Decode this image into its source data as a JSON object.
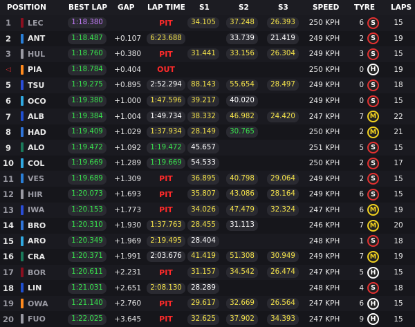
{
  "headers": {
    "position": "POSITION",
    "best_lap": "BEST LAP",
    "gap": "GAP",
    "lap_time": "LAP TIME",
    "s1": "S1",
    "s2": "S2",
    "s3": "S3",
    "speed": "SPEED",
    "tyre": "TYRE",
    "laps": "LAPS"
  },
  "colors": {
    "purple": "#c77dff",
    "green": "#38e54d",
    "yellow": "#f4e34a",
    "red": "#ff2a2a",
    "soft": "#e33131",
    "medium": "#f2d21f",
    "hard": "#ffffff"
  },
  "rows": [
    {
      "pos": "1",
      "team_color": "#8b0f1f",
      "name": "LEC",
      "best": "1:18.380",
      "best_style": "purple",
      "gap": "",
      "lap": "PIT",
      "lap_style": "pit",
      "s1": "34.105",
      "s1_style": "yellow",
      "s2": "37.248",
      "s2_style": "yellow",
      "s3": "26.393",
      "s3_style": "yellow",
      "speed": "250 KPH",
      "tyre_num": "6",
      "tyre": "S",
      "tyre_type": "soft",
      "laps": "15",
      "dim": true
    },
    {
      "pos": "2",
      "team_color": "#2a7fd8",
      "name": "ANT",
      "best": "1:18.487",
      "best_style": "green",
      "gap": "+0.107",
      "lap": "6:23.688",
      "lap_style": "yellow",
      "s1": "",
      "s1_style": "",
      "s2": "33.739",
      "s2_style": "white",
      "s3": "21.419",
      "s3_style": "white",
      "speed": "249 KPH",
      "tyre_num": "2",
      "tyre": "S",
      "tyre_type": "soft",
      "laps": "19",
      "dim": false
    },
    {
      "pos": "3",
      "team_color": "#9a9aa3",
      "name": "HUL",
      "best": "1:18.760",
      "best_style": "green",
      "gap": "+0.380",
      "lap": "PIT",
      "lap_style": "pit",
      "s1": "31.441",
      "s1_style": "yellow",
      "s2": "33.156",
      "s2_style": "yellow",
      "s3": "26.304",
      "s3_style": "yellow",
      "speed": "249 KPH",
      "tyre_num": "3",
      "tyre": "S",
      "tyre_type": "soft",
      "laps": "15",
      "dim": true
    },
    {
      "pos": "◁",
      "team_color": "#ff8a1e",
      "name": "PIA",
      "best": "1:18.784",
      "best_style": "green",
      "gap": "+0.404",
      "lap": "OUT",
      "lap_style": "out",
      "s1": "",
      "s1_style": "",
      "s2": "",
      "s2_style": "",
      "s3": "",
      "s3_style": "",
      "speed": "250 KPH",
      "tyre_num": "0",
      "tyre": "H",
      "tyre_type": "hard",
      "laps": "19",
      "dim": false
    },
    {
      "pos": "5",
      "team_color": "#2a4dd8",
      "name": "TSU",
      "best": "1:19.275",
      "best_style": "green",
      "gap": "+0.895",
      "lap": "2:52.294",
      "lap_style": "white",
      "s1": "88.143",
      "s1_style": "yellow",
      "s2": "55.654",
      "s2_style": "yellow",
      "s3": "28.497",
      "s3_style": "yellow",
      "speed": "249 KPH",
      "tyre_num": "0",
      "tyre": "S",
      "tyre_type": "soft",
      "laps": "18",
      "dim": false
    },
    {
      "pos": "6",
      "team_color": "#2fa8e0",
      "name": "OCO",
      "best": "1:19.380",
      "best_style": "green",
      "gap": "+1.000",
      "lap": "1:47.596",
      "lap_style": "yellow",
      "s1": "39.217",
      "s1_style": "yellow",
      "s2": "40.020",
      "s2_style": "white",
      "s3": "",
      "s3_style": "",
      "speed": "249 KPH",
      "tyre_num": "0",
      "tyre": "S",
      "tyre_type": "soft",
      "laps": "15",
      "dim": false
    },
    {
      "pos": "7",
      "team_color": "#1f4fd0",
      "name": "ALB",
      "best": "1:19.384",
      "best_style": "green",
      "gap": "+1.004",
      "lap": "1:49.734",
      "lap_style": "white",
      "s1": "38.332",
      "s1_style": "yellow",
      "s2": "46.982",
      "s2_style": "yellow",
      "s3": "24.420",
      "s3_style": "yellow",
      "speed": "247 KPH",
      "tyre_num": "7",
      "tyre": "M",
      "tyre_type": "medium",
      "laps": "22",
      "dim": false
    },
    {
      "pos": "8",
      "team_color": "#2f74d8",
      "name": "HAD",
      "best": "1:19.409",
      "best_style": "green",
      "gap": "+1.029",
      "lap": "1:37.934",
      "lap_style": "yellow",
      "s1": "28.149",
      "s1_style": "yellow",
      "s2": "30.765",
      "s2_style": "green",
      "s3": "",
      "s3_style": "",
      "speed": "250 KPH",
      "tyre_num": "2",
      "tyre": "M",
      "tyre_type": "medium",
      "laps": "21",
      "dim": false
    },
    {
      "pos": "9",
      "team_color": "#1a7a5a",
      "name": "ALO",
      "best": "1:19.472",
      "best_style": "green",
      "gap": "+1.092",
      "lap": "1:19.472",
      "lap_style": "green",
      "s1": "45.657",
      "s1_style": "white",
      "s2": "",
      "s2_style": "",
      "s3": "",
      "s3_style": "",
      "speed": "251 KPH",
      "tyre_num": "5",
      "tyre": "S",
      "tyre_type": "soft",
      "laps": "15",
      "dim": false
    },
    {
      "pos": "10",
      "team_color": "#2fa8e0",
      "name": "COL",
      "best": "1:19.669",
      "best_style": "green",
      "gap": "+1.289",
      "lap": "1:19.669",
      "lap_style": "green",
      "s1": "54.533",
      "s1_style": "white",
      "s2": "",
      "s2_style": "",
      "s3": "",
      "s3_style": "",
      "speed": "250 KPH",
      "tyre_num": "2",
      "tyre": "S",
      "tyre_type": "soft",
      "laps": "17",
      "dim": false
    },
    {
      "pos": "11",
      "team_color": "#2a7fd8",
      "name": "VES",
      "best": "1:19.689",
      "best_style": "green",
      "gap": "+1.309",
      "lap": "PIT",
      "lap_style": "pit",
      "s1": "36.895",
      "s1_style": "yellow",
      "s2": "40.798",
      "s2_style": "yellow",
      "s3": "29.064",
      "s3_style": "yellow",
      "speed": "249 KPH",
      "tyre_num": "2",
      "tyre": "S",
      "tyre_type": "soft",
      "laps": "15",
      "dim": true
    },
    {
      "pos": "12",
      "team_color": "#9a9aa3",
      "name": "HIR",
      "best": "1:20.073",
      "best_style": "green",
      "gap": "+1.693",
      "lap": "PIT",
      "lap_style": "pit",
      "s1": "35.807",
      "s1_style": "yellow",
      "s2": "43.086",
      "s2_style": "yellow",
      "s3": "28.164",
      "s3_style": "yellow",
      "speed": "249 KPH",
      "tyre_num": "6",
      "tyre": "S",
      "tyre_type": "soft",
      "laps": "15",
      "dim": true
    },
    {
      "pos": "13",
      "team_color": "#2a4dd8",
      "name": "IWA",
      "best": "1:20.153",
      "best_style": "green",
      "gap": "+1.773",
      "lap": "PIT",
      "lap_style": "pit",
      "s1": "34.026",
      "s1_style": "yellow",
      "s2": "47.479",
      "s2_style": "yellow",
      "s3": "32.324",
      "s3_style": "yellow",
      "speed": "247 KPH",
      "tyre_num": "6",
      "tyre": "M",
      "tyre_type": "medium",
      "laps": "19",
      "dim": true
    },
    {
      "pos": "14",
      "team_color": "#2f74d8",
      "name": "BRO",
      "best": "1:20.310",
      "best_style": "green",
      "gap": "+1.930",
      "lap": "1:37.763",
      "lap_style": "yellow",
      "s1": "28.455",
      "s1_style": "yellow",
      "s2": "31.113",
      "s2_style": "white",
      "s3": "",
      "s3_style": "",
      "speed": "246 KPH",
      "tyre_num": "7",
      "tyre": "M",
      "tyre_type": "medium",
      "laps": "20",
      "dim": false
    },
    {
      "pos": "15",
      "team_color": "#2fa8e0",
      "name": "ARO",
      "best": "1:20.349",
      "best_style": "green",
      "gap": "+1.969",
      "lap": "2:19.495",
      "lap_style": "yellow",
      "s1": "28.404",
      "s1_style": "white",
      "s2": "",
      "s2_style": "",
      "s3": "",
      "s3_style": "",
      "speed": "248 KPH",
      "tyre_num": "1",
      "tyre": "S",
      "tyre_type": "soft",
      "laps": "18",
      "dim": false
    },
    {
      "pos": "16",
      "team_color": "#1a7a5a",
      "name": "CRA",
      "best": "1:20.371",
      "best_style": "green",
      "gap": "+1.991",
      "lap": "2:03.676",
      "lap_style": "white",
      "s1": "41.419",
      "s1_style": "yellow",
      "s2": "51.308",
      "s2_style": "yellow",
      "s3": "30.949",
      "s3_style": "yellow",
      "speed": "249 KPH",
      "tyre_num": "7",
      "tyre": "M",
      "tyre_type": "medium",
      "laps": "19",
      "dim": false
    },
    {
      "pos": "17",
      "team_color": "#8b0f1f",
      "name": "BOR",
      "best": "1:20.611",
      "best_style": "green",
      "gap": "+2.231",
      "lap": "PIT",
      "lap_style": "pit",
      "s1": "31.157",
      "s1_style": "yellow",
      "s2": "34.542",
      "s2_style": "yellow",
      "s3": "26.474",
      "s3_style": "yellow",
      "speed": "247 KPH",
      "tyre_num": "5",
      "tyre": "H",
      "tyre_type": "hard",
      "laps": "15",
      "dim": true
    },
    {
      "pos": "18",
      "team_color": "#1f4fd0",
      "name": "LIN",
      "best": "1:21.031",
      "best_style": "green",
      "gap": "+2.651",
      "lap": "2:08.130",
      "lap_style": "yellow",
      "s1": "28.289",
      "s1_style": "white",
      "s2": "",
      "s2_style": "",
      "s3": "",
      "s3_style": "",
      "speed": "248 KPH",
      "tyre_num": "4",
      "tyre": "S",
      "tyre_type": "soft",
      "laps": "18",
      "dim": false
    },
    {
      "pos": "19",
      "team_color": "#ff8a1e",
      "name": "OWA",
      "best": "1:21.140",
      "best_style": "green",
      "gap": "+2.760",
      "lap": "PIT",
      "lap_style": "pit",
      "s1": "29.617",
      "s1_style": "yellow",
      "s2": "32.669",
      "s2_style": "yellow",
      "s3": "26.564",
      "s3_style": "yellow",
      "speed": "247 KPH",
      "tyre_num": "6",
      "tyre": "H",
      "tyre_type": "hard",
      "laps": "15",
      "dim": true
    },
    {
      "pos": "20",
      "team_color": "#9a9aa3",
      "name": "FUO",
      "best": "1:22.025",
      "best_style": "green",
      "gap": "+3.645",
      "lap": "PIT",
      "lap_style": "pit",
      "s1": "32.625",
      "s1_style": "yellow",
      "s2": "37.902",
      "s2_style": "yellow",
      "s3": "34.393",
      "s3_style": "yellow",
      "speed": "247 KPH",
      "tyre_num": "9",
      "tyre": "H",
      "tyre_type": "hard",
      "laps": "15",
      "dim": true
    }
  ]
}
